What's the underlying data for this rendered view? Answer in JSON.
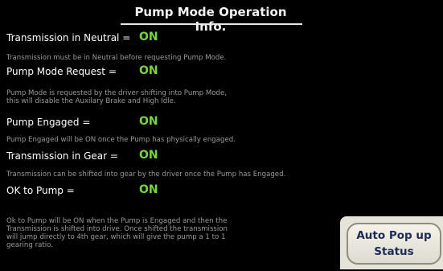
{
  "title": "Pump Mode Operation Info.",
  "items": [
    {
      "label": "Transmission in Neutral =",
      "value": "ON",
      "description": [
        "Transmission must be in Neutral before requesting Pump Mode."
      ]
    },
    {
      "label": "Pump Mode Request =",
      "value": "ON",
      "description": [
        "Pump Mode is requested by the driver shifting into Pump Mode,",
        "this will disable the Auxilary Brake and High Idle."
      ]
    },
    {
      "label": "Pump Engaged =",
      "value": "ON",
      "description": [
        "Pump Engaged will be ON once the Pump has physically engaged."
      ]
    },
    {
      "label": "Transmission in Gear =",
      "value": "ON",
      "description": [
        "Transmission can be shifted into gear by the driver once the Pump has Engaged."
      ]
    },
    {
      "label": "OK to Pump =",
      "value": "ON",
      "description": [
        "Ok to Pump will be ON when the Pump is Engaged and then the",
        "Transmission is shifted into drive.  Once shifted the transmission",
        "will jump directly to 4th gear, which will give the pump a 1 to 1",
        "gearing ratio."
      ]
    }
  ],
  "popup_button": {
    "line1": "Auto Pop up",
    "line2": "Status"
  },
  "colors": {
    "background": "#000000",
    "on_value": "#77d63a",
    "description_text": "#9a9a9a",
    "button_text": "#1c2b57"
  }
}
